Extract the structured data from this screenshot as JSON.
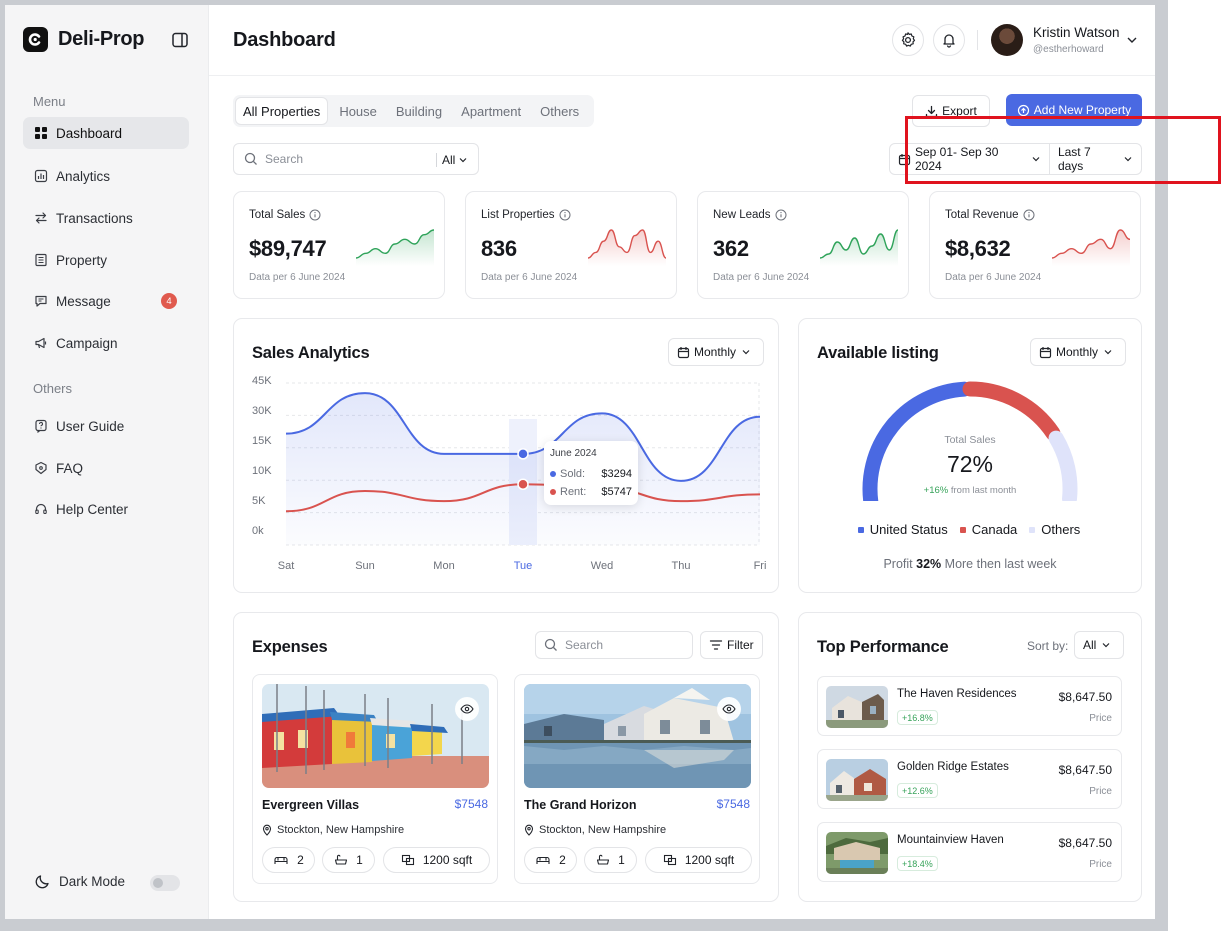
{
  "app": {
    "name": "Deli-Prop"
  },
  "sidebar": {
    "menu_label": "Menu",
    "items": [
      {
        "label": "Dashboard",
        "icon": "grid-icon",
        "active": true
      },
      {
        "label": "Analytics",
        "icon": "chart-icon"
      },
      {
        "label": "Transactions",
        "icon": "arrows-icon"
      },
      {
        "label": "Property",
        "icon": "building-icon"
      },
      {
        "label": "Message",
        "icon": "message-icon",
        "badge": "4"
      },
      {
        "label": "Campaign",
        "icon": "megaphone-icon"
      }
    ],
    "others_label": "Others",
    "others": [
      {
        "label": "User Guide",
        "icon": "help-book-icon"
      },
      {
        "label": "FAQ",
        "icon": "faq-icon"
      },
      {
        "label": "Help Center",
        "icon": "headphones-icon"
      }
    ],
    "dark_mode_label": "Dark Mode",
    "dark_mode_on": false
  },
  "header": {
    "title": "Dashboard",
    "user": {
      "name": "Kristin Watson",
      "handle": "@estherhoward"
    }
  },
  "toolbar": {
    "tabs": [
      "All Properties",
      "House",
      "Building",
      "Apartment",
      "Others"
    ],
    "active_tab": "All Properties",
    "export_label": "Export",
    "add_label": "Add New Property",
    "search_placeholder": "Search",
    "search_filter": "All",
    "date_range": "Sep 01- Sep 30 2024",
    "period": "Last 7 days"
  },
  "stats": [
    {
      "label": "Total Sales",
      "value": "$89,747",
      "sub": "Data per 6 June 2024",
      "trend": "up",
      "color": "#2fa35a",
      "spark": [
        3,
        4,
        5,
        4,
        6,
        7,
        6,
        8,
        9
      ]
    },
    {
      "label": "List Properties",
      "value": "836",
      "sub": "Data per 6 June 2024",
      "trend": "down",
      "color": "#d9534f",
      "spark": [
        3,
        4,
        6,
        8,
        5,
        4,
        7,
        8,
        4,
        6,
        3
      ]
    },
    {
      "label": "New Leads",
      "value": "362",
      "sub": "Data per 6 June 2024",
      "trend": "up",
      "color": "#2fa35a",
      "spark": [
        2,
        3,
        6,
        4,
        7,
        3,
        5,
        8,
        4,
        9
      ]
    },
    {
      "label": "Total Revenue",
      "value": "$8,632",
      "sub": "Data per 6 June 2024",
      "trend": "up",
      "color": "#d9534f",
      "spark": [
        3,
        4,
        5,
        4,
        6,
        7,
        5,
        9,
        7
      ]
    }
  ],
  "sales_analytics": {
    "title": "Sales Analytics",
    "period": "Monthly",
    "tooltip": {
      "title": "June 2024",
      "sold_label": "Sold:",
      "sold": "$3294",
      "rent_label": "Rent:",
      "rent": "$5747"
    }
  },
  "chart_data": {
    "type": "line",
    "title": "Sales Analytics",
    "x": [
      "Sat",
      "Sun",
      "Mon",
      "Tue",
      "Wed",
      "Thu",
      "Fri"
    ],
    "yticks": [
      "45K",
      "30K",
      "15K",
      "10K",
      "5K",
      "0k"
    ],
    "highlight_x": "Tue",
    "series": [
      {
        "name": "Sold",
        "color": "#4a69e2",
        "values": [
          33,
          45,
          27,
          27,
          39,
          19,
          38
        ]
      },
      {
        "name": "Rent",
        "color": "#d9534f",
        "values": [
          10,
          16,
          13,
          18,
          17,
          13,
          15
        ]
      }
    ],
    "grid": true
  },
  "available_listing": {
    "title": "Available listing",
    "period": "Monthly",
    "center_label": "Total Sales",
    "center_value": "72%",
    "delta": "+16%",
    "delta_suffix": "from last month",
    "segments": [
      {
        "label": "United Status",
        "color": "#4a69e2",
        "share": 0.5
      },
      {
        "label": "Canada",
        "color": "#d9534f",
        "share": 0.3
      },
      {
        "label": "Others",
        "color": "#dfe3fa",
        "share": 0.2
      }
    ],
    "profit_prefix": "Profit",
    "profit_value": "32%",
    "profit_suffix": "More then last week"
  },
  "expenses": {
    "title": "Expenses",
    "search_placeholder": "Search",
    "filter_label": "Filter",
    "items": [
      {
        "name": "Evergreen Villas",
        "price": "$7548",
        "location": "Stockton, New Hampshire",
        "beds": "2",
        "baths": "1",
        "area": "1200 sqft"
      },
      {
        "name": "The Grand Horizon",
        "price": "$7548",
        "location": "Stockton, New Hampshire",
        "beds": "2",
        "baths": "1",
        "area": "1200 sqft"
      }
    ]
  },
  "top_performance": {
    "title": "Top Performance",
    "sort_label": "Sort by:",
    "sort_value": "All",
    "items": [
      {
        "name": "The Haven Residences",
        "change": "+16.8%",
        "price": "$8,647.50",
        "price_label": "Price"
      },
      {
        "name": "Golden Ridge Estates",
        "change": "+12.6%",
        "price": "$8,647.50",
        "price_label": "Price"
      },
      {
        "name": "Mountainview Haven",
        "change": "+18.4%",
        "price": "$8,647.50",
        "price_label": "Price"
      }
    ]
  }
}
